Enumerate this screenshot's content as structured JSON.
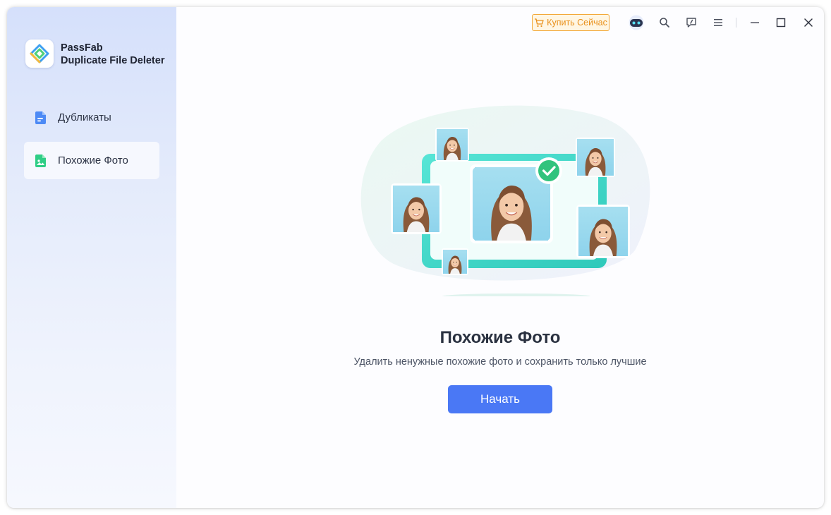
{
  "app": {
    "name_line1": "PassFab",
    "name_line2": "Duplicate File Deleter"
  },
  "sidebar": {
    "items": [
      {
        "label": "Дубликаты",
        "icon": "document-icon",
        "active": false
      },
      {
        "label": "Похожие Фото",
        "icon": "image-icon",
        "active": true
      }
    ]
  },
  "titlebar": {
    "buy_label": "Купить Сейчас",
    "icons": [
      "cart-icon",
      "robot-icon",
      "search-icon",
      "feedback-icon",
      "menu-icon",
      "minimize-icon",
      "maximize-icon",
      "close-icon"
    ]
  },
  "main": {
    "title": "Похожие Фото",
    "subtitle": "Удалить ненужные похожие фото и сохранить только лучшие",
    "start_label": "Начать"
  },
  "colors": {
    "accent": "#4a78f5",
    "buy": "#e9901a",
    "frame": "#3fd7c6",
    "check": "#31c37d",
    "doc_icon": "#4d8af5",
    "image_icon": "#2fce86"
  }
}
